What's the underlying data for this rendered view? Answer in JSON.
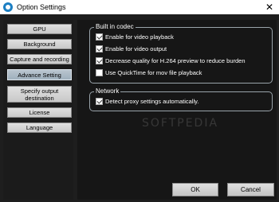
{
  "window": {
    "title": "Option Settings",
    "close_glyph": "✕",
    "icon": "app-icon"
  },
  "sidebar": {
    "items": [
      {
        "label": "GPU"
      },
      {
        "label": "Background"
      },
      {
        "label": "Capture and recording"
      },
      {
        "label": "Advance Setting",
        "selected": true
      },
      {
        "label": "Specify output destination"
      },
      {
        "label": "License"
      },
      {
        "label": "Language"
      }
    ]
  },
  "codec_group": {
    "title": "Built in codec",
    "options": [
      {
        "label": "Enable for video playback",
        "checked": true
      },
      {
        "label": "Enable for video output",
        "checked": true
      },
      {
        "label": "Decrease quality for H.264 preview to reduce burden",
        "checked": true
      },
      {
        "label": "Use QuickTime for mov file playback",
        "checked": false
      }
    ]
  },
  "network_group": {
    "title": "Network",
    "options": [
      {
        "label": "Detect proxy settings automatically.",
        "checked": true
      }
    ]
  },
  "footer": {
    "ok_label": "OK",
    "cancel_label": "Cancel"
  },
  "watermark": "SOFTPEDIA"
}
